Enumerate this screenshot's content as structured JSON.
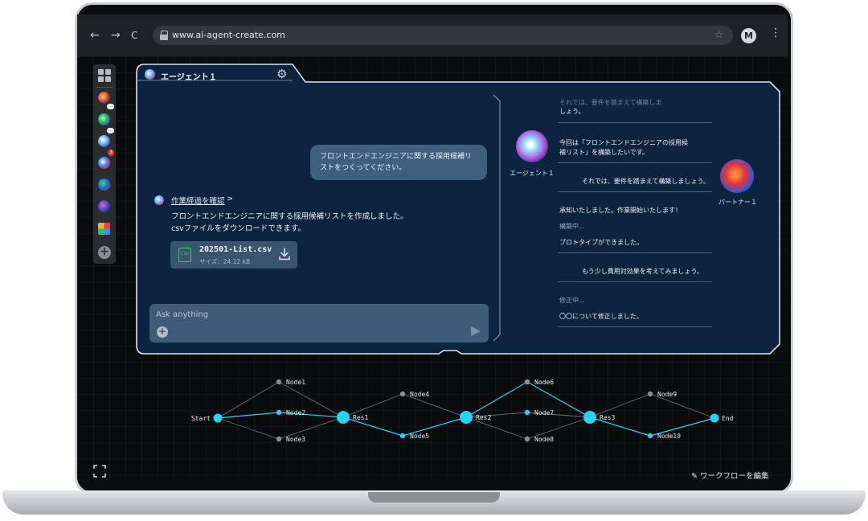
{
  "browser": {
    "url": "www.ai-agent-create.com",
    "profile_initial": "M",
    "back": "←",
    "forward": "→",
    "reload": "C",
    "star": "☆",
    "menu": "⋮"
  },
  "sidebar": {
    "add": "+",
    "badge_count": "3"
  },
  "panel": {
    "tab_title": "エージェント１",
    "user_message": "フロントエンドエンジニアに関する採用候補リストをつくってください。",
    "process_link": "作業経過を確認",
    "process_arrow": ">",
    "agent_reply_line1": "フロントエンドエンジニアに関する採用候補リストを作成しました。",
    "agent_reply_line2": "csvファイルをダウンロードできます。",
    "file": {
      "icon_label": "CSV",
      "name": "202501-List.csv",
      "size": "サイズ：24.12 kB"
    },
    "input_placeholder": "Ask anything"
  },
  "conversation_log": {
    "agent_label": "エージェント１",
    "partner_label": "パートナー１",
    "faded_top": "それでは、要件を踏まえて構築しま",
    "line_top": "しょう。",
    "agent_msg1_l1": "今回は「フロントエンドエンジニアの採用候",
    "agent_msg1_l2": "補リスト」を構築したいです。",
    "partner_msg1": "それでは、要件を踏まえて構築しましょう。",
    "agent_msg2": "承知いたしました。作業開始いたします！",
    "status1": "構築中...",
    "agent_msg3": "プロトタイプができました。",
    "partner_msg2": "もう少し費用対効果を考えてみましょう。",
    "status2": "修正中...",
    "agent_msg4": "〇〇について修正しました。"
  },
  "workflow": {
    "nodes": [
      "Start",
      "Node1",
      "Node2",
      "Node3",
      "Res1",
      "Node4",
      "Node5",
      "Res2",
      "Node6",
      "Node7",
      "Node8",
      "Res3",
      "Node9",
      "Node10",
      "End"
    ],
    "edit_label": "ワークフローを編集",
    "colors": {
      "active": "#29d3f5",
      "inactive": "#8a8f96"
    }
  },
  "colors": {
    "panel_bg": "#0c2440",
    "panel_border": "#d5e3f0",
    "bubble": "#3e5f7e"
  }
}
